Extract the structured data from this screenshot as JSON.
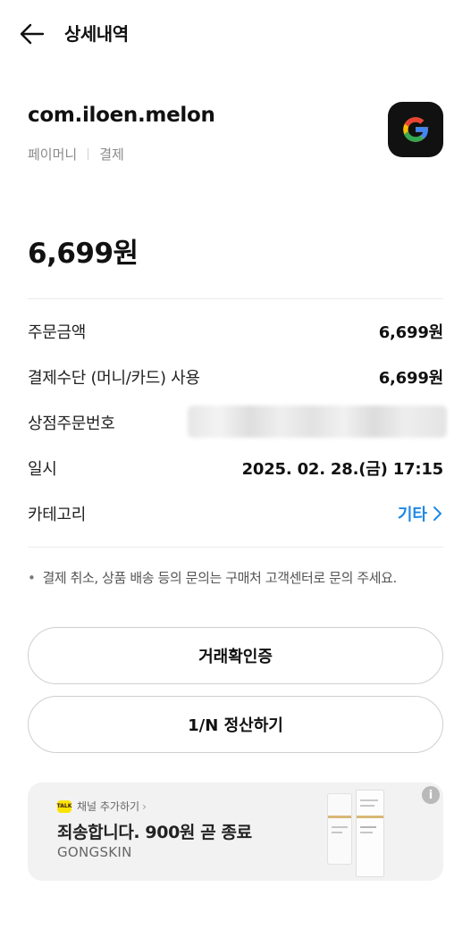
{
  "header": {
    "title": "상세내역",
    "back_icon": "arrow-left-icon"
  },
  "merchant": {
    "name": "com.iloen.melon",
    "provider": "페이머니",
    "type": "결제",
    "app_icon": "google-icon"
  },
  "amount": "6,699원",
  "details": {
    "order_amount": {
      "label": "주문금액",
      "value": "6,699원"
    },
    "payment_method": {
      "label": "결제수단 (머니/카드) 사용",
      "value": "6,699원"
    },
    "store_order_no": {
      "label": "상점주문번호",
      "value": ""
    },
    "datetime": {
      "label": "일시",
      "value": "2025. 02. 28.(금) 17:15"
    },
    "category": {
      "label": "카테고리",
      "value": "기타"
    }
  },
  "notice": "결제 취소, 상품 배송 등의 문의는 구매처 고객센터로 문의 주세요.",
  "buttons": {
    "transaction_cert": "거래확인증",
    "split_bill": "1/N 정산하기"
  },
  "ad": {
    "channel_label": "채널 추가하기",
    "title": "죄송합니다. 900원 곧 종료",
    "brand": "GONGSKIN",
    "info_icon": "info-icon",
    "accent": "#fbe300"
  },
  "colors": {
    "link": "#1e88e5",
    "google_red": "#ea4335",
    "google_blue": "#4285f4",
    "google_yellow": "#fbbc05",
    "google_green": "#34a853"
  }
}
